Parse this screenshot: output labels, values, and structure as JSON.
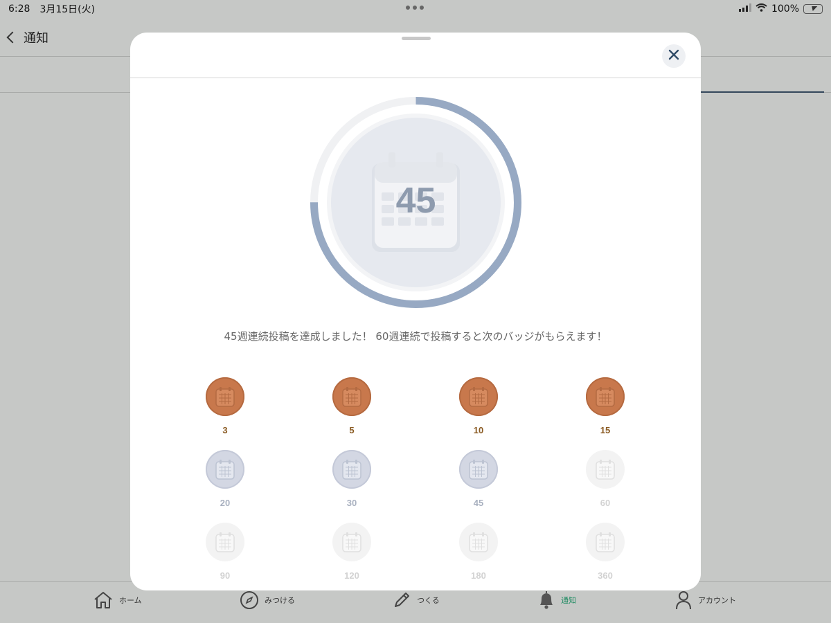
{
  "status_bar": {
    "time": "6:28",
    "date": "3月15日(火)",
    "battery": "100%"
  },
  "nav": {
    "back_label": "通知"
  },
  "modal": {
    "achieved_weeks": "45",
    "progress_fraction": 0.75,
    "message": "45週連続投稿を達成しました！ 60週連続で投稿すると次のバッジがもらえます！",
    "badges": [
      {
        "label": "3",
        "state": "bronze"
      },
      {
        "label": "5",
        "state": "bronze"
      },
      {
        "label": "10",
        "state": "bronze"
      },
      {
        "label": "15",
        "state": "bronze"
      },
      {
        "label": "20",
        "state": "silver"
      },
      {
        "label": "30",
        "state": "silver"
      },
      {
        "label": "45",
        "state": "silver"
      },
      {
        "label": "60",
        "state": "locked"
      },
      {
        "label": "90",
        "state": "locked"
      },
      {
        "label": "120",
        "state": "locked"
      },
      {
        "label": "180",
        "state": "locked"
      },
      {
        "label": "360",
        "state": "locked"
      }
    ]
  },
  "tab_bar": {
    "items": [
      {
        "label": "ホーム",
        "icon": "home-icon"
      },
      {
        "label": "みつける",
        "icon": "compass-icon"
      },
      {
        "label": "つくる",
        "icon": "pencil-icon"
      },
      {
        "label": "通知",
        "icon": "bell-icon",
        "active": true
      },
      {
        "label": "アカウント",
        "icon": "person-icon"
      }
    ]
  },
  "colors": {
    "bronze": "#c8784c",
    "silver": "#d3d7e3",
    "locked": "#f3f3f3",
    "progress": "#97a9c3",
    "active_tab": "#1c8a60"
  }
}
